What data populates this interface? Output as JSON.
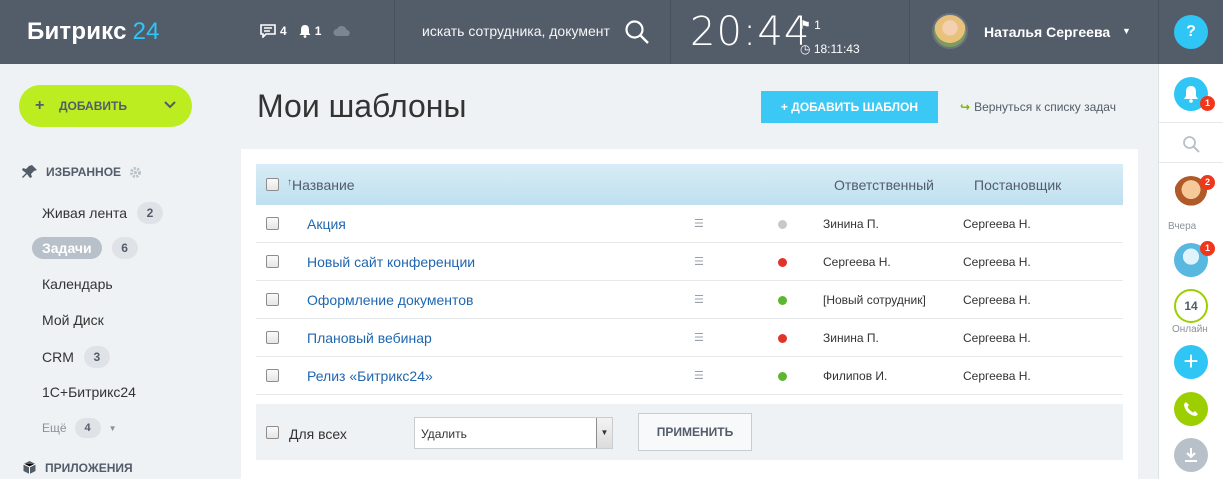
{
  "header": {
    "logo_text": "Битрикс",
    "logo_num": "24",
    "chat_count": "4",
    "notif_count": "1",
    "search_placeholder": "искать сотрудника, документ",
    "time": "20:44",
    "flag_count": "1",
    "work_time": "18:11:43",
    "user_name": "Наталья Сергеева",
    "help_label": "?"
  },
  "sidebar": {
    "add_label": "ДОБАВИТЬ",
    "favorites_label": "ИЗБРАННОЕ",
    "items": [
      {
        "label": "Живая лента",
        "count": "2"
      },
      {
        "label": "Задачи",
        "count": "6"
      },
      {
        "label": "Календарь",
        "count": ""
      },
      {
        "label": "Мой Диск",
        "count": ""
      },
      {
        "label": "CRM",
        "count": "3"
      },
      {
        "label": "1С+Битрикс24",
        "count": ""
      }
    ],
    "more_label": "Ещё",
    "more_count": "4",
    "apps_label": "ПРИЛОЖЕНИЯ"
  },
  "main": {
    "title": "Мои шаблоны",
    "add_template_label": "ДОБАВИТЬ ШАБЛОН",
    "back_label": "Вернуться к списку задач",
    "columns": {
      "name": "Название",
      "responsible": "Ответственный",
      "setter": "Постановщик"
    },
    "rows": [
      {
        "name": "Акция",
        "status": "#c8c8c8",
        "responsible": "Зинина П.",
        "setter": "Сергеева Н."
      },
      {
        "name": "Новый сайт конференции",
        "status": "#e0342b",
        "responsible": "Сергеева Н.",
        "setter": "Сергеева Н."
      },
      {
        "name": "Оформление документов",
        "status": "#5db531",
        "responsible": "[Новый сотрудник]",
        "setter": "Сергеева Н."
      },
      {
        "name": "Плановый вебинар",
        "status": "#e0342b",
        "responsible": "Зинина П.",
        "setter": "Сергеева Н."
      },
      {
        "name": "Релиз «Битрикс24»",
        "status": "#5db531",
        "responsible": "Филипов И.",
        "setter": "Сергеева Н."
      }
    ],
    "footer": {
      "for_all_label": "Для всех",
      "action_value": "Удалить",
      "apply_label": "ПРИМЕНИТЬ"
    }
  },
  "rail": {
    "notif_badge": "1",
    "chat1_badge": "2",
    "yesterday_label": "Вчера",
    "chat2_badge": "1",
    "online_count": "14",
    "online_label": "Онлайн"
  },
  "colors": {
    "accent": "#2fc6f6",
    "add_green": "#bbed21",
    "header_bg": "#535c69",
    "link": "#2067b0"
  }
}
